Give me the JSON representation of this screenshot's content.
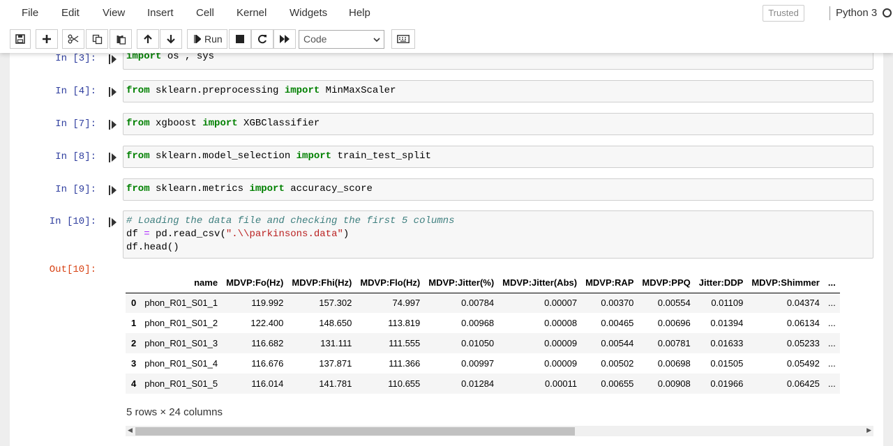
{
  "menu": [
    "File",
    "Edit",
    "View",
    "Insert",
    "Cell",
    "Kernel",
    "Widgets",
    "Help"
  ],
  "header": {
    "trusted": "Trusted",
    "kernel": "Python 3"
  },
  "toolbar": {
    "run_label": "Run",
    "cell_type": "Code",
    "icons": [
      "save-icon",
      "add-cell-icon",
      "cut-icon",
      "copy-icon",
      "paste-icon",
      "move-up-icon",
      "move-down-icon",
      "run-icon",
      "stop-icon",
      "restart-icon",
      "fast-forward-icon",
      "keyboard-icon"
    ]
  },
  "cells": [
    {
      "prompt": "In [3]:"
    },
    {
      "prompt": "In [4]:"
    },
    {
      "prompt": "In [7]:"
    },
    {
      "prompt": "In [8]:"
    },
    {
      "prompt": "In [9]:"
    },
    {
      "prompt": "In [10]:"
    }
  ],
  "code": {
    "c3_kw1": "import",
    "c3_rest": " os , sys",
    "c4_kw1": "from",
    "c4_mod": " sklearn.preprocessing ",
    "c4_kw2": "import",
    "c4_name": " MinMaxScaler",
    "c7_kw1": "from",
    "c7_mod": " xgboost ",
    "c7_kw2": "import",
    "c7_name": " XGBClassifier",
    "c8_kw1": "from",
    "c8_mod": " sklearn.model_selection ",
    "c8_kw2": "import",
    "c8_name": " train_test_split",
    "c9_kw1": "from",
    "c9_mod": " sklearn.metrics ",
    "c9_kw2": "import",
    "c9_name": " accuracy_score",
    "c10_comment": "# Loading the data file and checking the first 5 columns",
    "c10_l2_a": "df ",
    "c10_l2_eq": "=",
    "c10_l2_b": " pd.read_csv(",
    "c10_l2_str": "\".\\\\parkinsons.data\"",
    "c10_l2_c": ")",
    "c10_l3": "df.head()"
  },
  "output": {
    "prompt": "Out[10]:",
    "columns": [
      "",
      "name",
      "MDVP:Fo(Hz)",
      "MDVP:Fhi(Hz)",
      "MDVP:Flo(Hz)",
      "MDVP:Jitter(%)",
      "MDVP:Jitter(Abs)",
      "MDVP:RAP",
      "MDVP:PPQ",
      "Jitter:DDP",
      "MDVP:Shimmer",
      "..."
    ],
    "rows": [
      [
        "0",
        "phon_R01_S01_1",
        "119.992",
        "157.302",
        "74.997",
        "0.00784",
        "0.00007",
        "0.00370",
        "0.00554",
        "0.01109",
        "0.04374",
        "..."
      ],
      [
        "1",
        "phon_R01_S01_2",
        "122.400",
        "148.650",
        "113.819",
        "0.00968",
        "0.00008",
        "0.00465",
        "0.00696",
        "0.01394",
        "0.06134",
        "..."
      ],
      [
        "2",
        "phon_R01_S01_3",
        "116.682",
        "131.111",
        "111.555",
        "0.01050",
        "0.00009",
        "0.00544",
        "0.00781",
        "0.01633",
        "0.05233",
        "..."
      ],
      [
        "3",
        "phon_R01_S01_4",
        "116.676",
        "137.871",
        "111.366",
        "0.00997",
        "0.00009",
        "0.00502",
        "0.00698",
        "0.01505",
        "0.05492",
        "..."
      ],
      [
        "4",
        "phon_R01_S01_5",
        "116.014",
        "141.781",
        "110.655",
        "0.01284",
        "0.00011",
        "0.00655",
        "0.00908",
        "0.01966",
        "0.06425",
        "..."
      ]
    ],
    "shape": "5 rows × 24 columns"
  }
}
